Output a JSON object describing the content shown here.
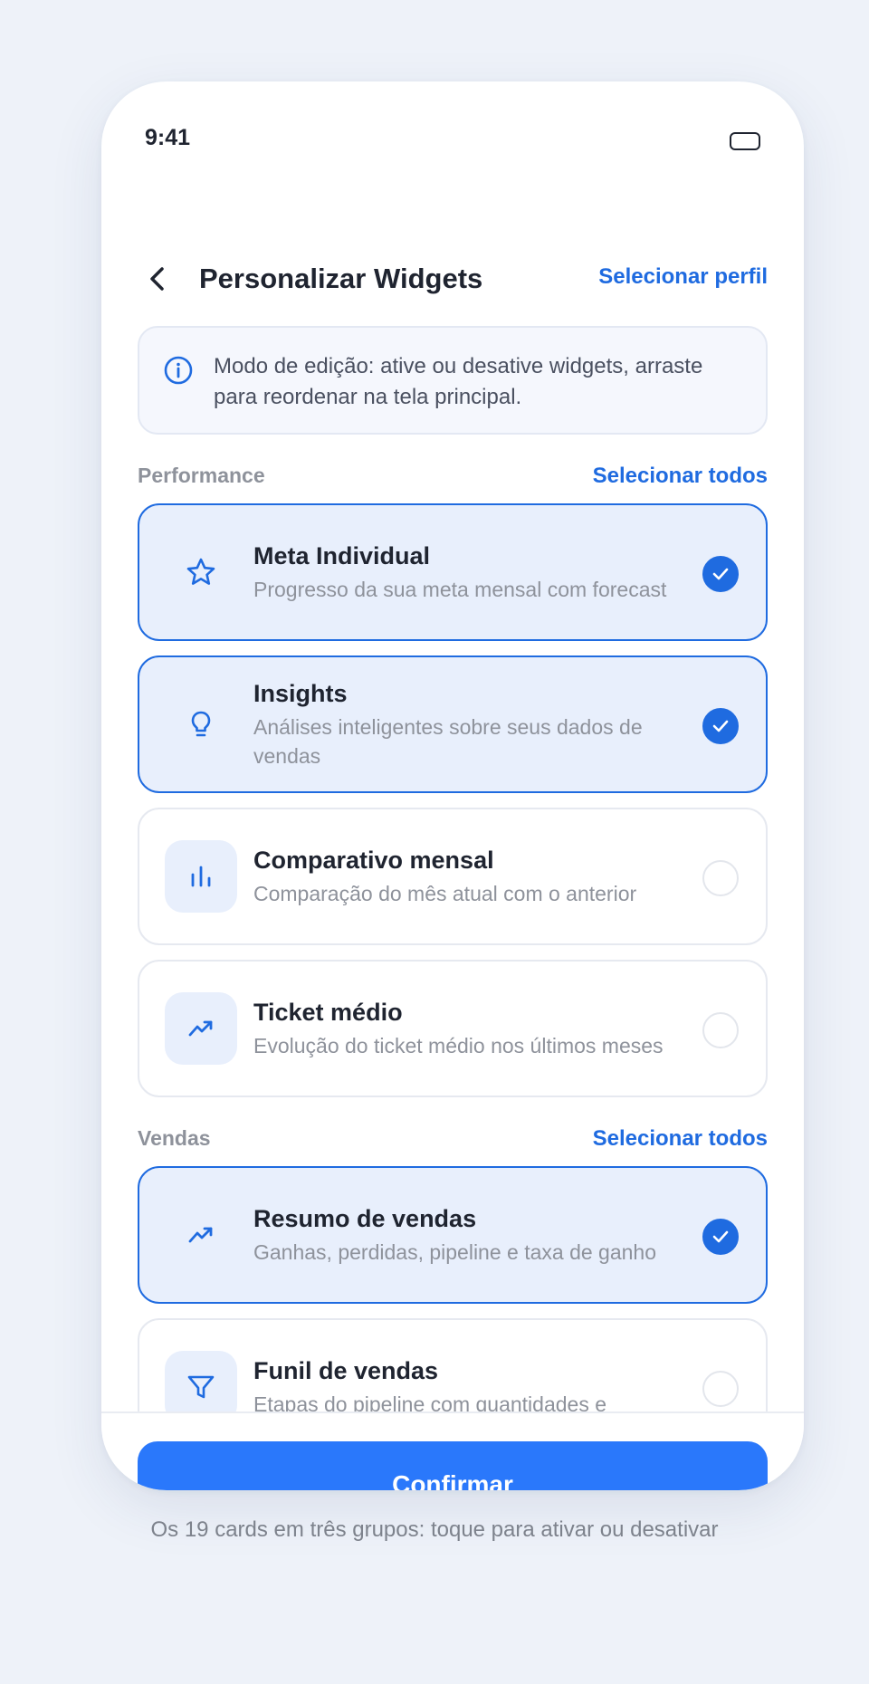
{
  "status_bar": {
    "time": "9:41"
  },
  "header": {
    "title": "Personalizar Widgets",
    "action": "Selecionar perfil"
  },
  "info": {
    "text": "Modo de edição: ative ou desative widgets, arraste para reordenar na tela principal.",
    "icon": "info-icon"
  },
  "sections": [
    {
      "title": "Performance",
      "action": "Selecionar todos",
      "cards": [
        {
          "title": "Meta Individual",
          "description": "Progresso da sua meta mensal com forecast",
          "icon": "star-icon",
          "selected": true
        },
        {
          "title": "Insights",
          "description": "Análises inteligentes sobre seus dados de vendas",
          "icon": "lightbulb-icon",
          "selected": true
        },
        {
          "title": "Comparativo mensal",
          "description": "Comparação do mês atual com o anterior",
          "icon": "bar-chart-icon",
          "selected": false
        },
        {
          "title": "Ticket médio",
          "description": "Evolução do ticket médio nos últimos meses",
          "icon": "trending-up-icon",
          "selected": false
        }
      ]
    },
    {
      "title": "Vendas",
      "action": "Selecionar todos",
      "cards": [
        {
          "title": "Resumo de vendas",
          "description": "Ganhas, perdidas, pipeline e taxa de ganho",
          "icon": "trending-up-icon",
          "selected": true
        },
        {
          "title": "Funil de vendas",
          "description": "Etapas do pipeline com quantidades e",
          "icon": "funnel-icon",
          "selected": false
        }
      ]
    }
  ],
  "footer": {
    "confirm_label": "Confirmar"
  },
  "caption": "Os 19 cards em três grupos: toque para ativar ou desativar",
  "colors": {
    "accent": "#1f6be0",
    "button": "#2a78fb",
    "selected_bg": "#e8effc",
    "background": "#eef2f9"
  }
}
